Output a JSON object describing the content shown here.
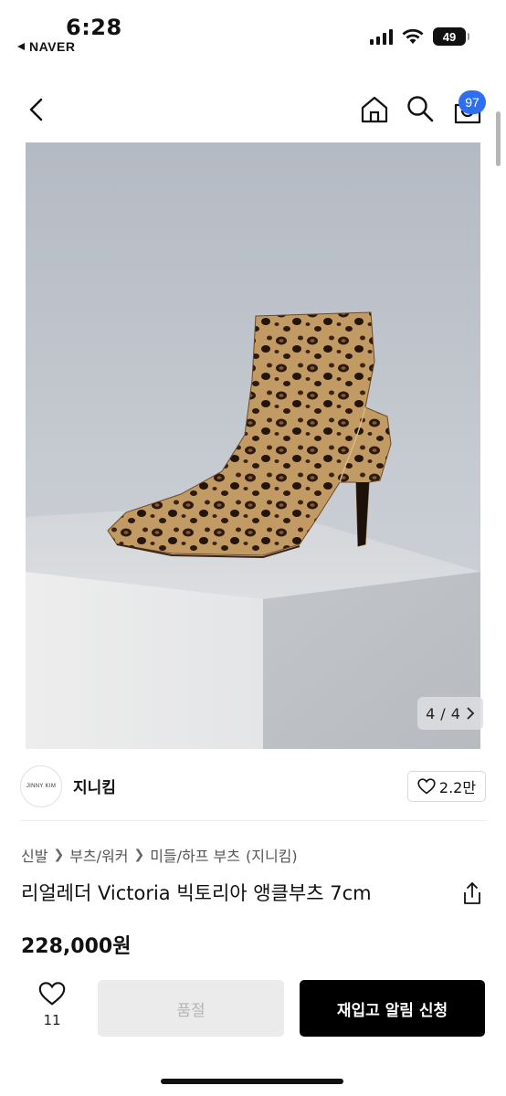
{
  "status_bar": {
    "time": "6:28",
    "back_app": "NAVER",
    "battery": "49"
  },
  "nav": {
    "cart_count": "97"
  },
  "gallery": {
    "current": "4",
    "separator": "/",
    "total": "4"
  },
  "brand": {
    "logo_text": "JINNY KIM",
    "name": "지니킴",
    "likes": "2.2만"
  },
  "breadcrumb": [
    "신발",
    "부츠/워커",
    "미들/하프 부츠",
    "(지니킴)"
  ],
  "product": {
    "title": "리얼레더 Victoria 빅토리아 앵클부츠 7cm",
    "price": "228,000원"
  },
  "actions": {
    "wish_count": "11",
    "soldout_label": "품절",
    "notify_label": "재입고 알림 신청"
  },
  "colors": {
    "accent_badge": "#2e6ff2",
    "primary_button": "#000000",
    "disabled_button": "#ebebeb"
  }
}
